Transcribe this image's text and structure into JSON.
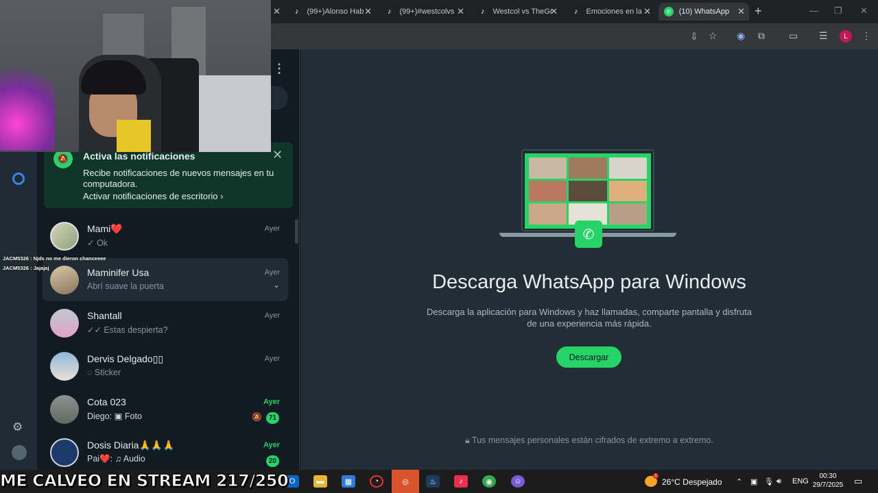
{
  "browser": {
    "tabs": [
      {
        "title": "",
        "icon": "close",
        "active": false
      },
      {
        "title": "(99+)Alonso Hab",
        "icon": "tiktok-icon",
        "active": false
      },
      {
        "title": "(99+)#westcolvs",
        "icon": "tiktok-icon",
        "active": false
      },
      {
        "title": "Westcol vs TheGr",
        "icon": "tiktok-icon",
        "active": false
      },
      {
        "title": "Emociones en la",
        "icon": "tiktok-icon",
        "active": false
      },
      {
        "title": "(10) WhatsApp",
        "icon": "whatsapp-icon",
        "active": true
      }
    ],
    "profile_initial": "L"
  },
  "notification_banner": {
    "title": "Activa las notificaciones",
    "body": "Recibe notificaciones de nuevos mensajes en tu computadora.",
    "link": "Activar notificaciones de escritorio"
  },
  "stream_chat": [
    "JACM5326 : Njds no me dieron chanceeee",
    "JACM5326 : Jajajaj"
  ],
  "chats": [
    {
      "name": "Mami❤️",
      "preview": "✓ Ok",
      "time": "Ayer",
      "unread": false,
      "badge": ""
    },
    {
      "name": "Maminifer Usa",
      "preview": "Abrí suave la puerta",
      "time": "Ayer",
      "unread": false,
      "badge": ""
    },
    {
      "name": "Shantall",
      "preview": "✓✓ Estas despierta?",
      "time": "Ayer",
      "unread": false,
      "badge": ""
    },
    {
      "name": "Dervis Delgado▯▯",
      "preview": "◌ Sticker",
      "time": "Ayer",
      "unread": false,
      "badge": ""
    },
    {
      "name": "Cota 023",
      "preview": "Diego: ▣ Foto",
      "time": "Ayer",
      "unread": true,
      "badge": "71"
    },
    {
      "name": "Dosis Diaria🙏🙏🙏",
      "preview": "Pai❤️: ♫ Audio",
      "time": "Ayer",
      "unread": true,
      "badge": "20"
    }
  ],
  "main": {
    "title": "Descarga WhatsApp para Windows",
    "description": "Descarga la aplicación para Windows y haz llamadas, comparte pantalla y disfruta de una experiencia más rápida.",
    "download_button": "Descargar",
    "encryption_note": "Tus mensajes personales están cifrados de extremo a extremo."
  },
  "taskbar": {
    "stream_overlay": "ME CALVEO EN STREAM 217/250",
    "weather": "26°C  Despejado",
    "weather_badge": "1",
    "language": "ENG",
    "time": "00:30",
    "date": "29/7/2025"
  },
  "colors": {
    "accent": "#25d366",
    "panel": "#111b21",
    "main_bg": "#222e35",
    "banner": "#103529"
  }
}
